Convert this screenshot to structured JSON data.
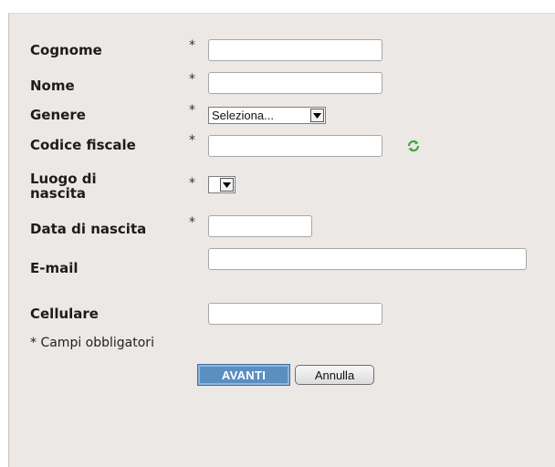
{
  "form": {
    "required_mark": "*",
    "fields": {
      "cognome": {
        "label": "Cognome",
        "value": ""
      },
      "nome": {
        "label": "Nome",
        "value": ""
      },
      "genere": {
        "label": "Genere",
        "selected": "Seleziona..."
      },
      "codice_fiscale": {
        "label": "Codice fiscale",
        "value": ""
      },
      "luogo_line1": "Luogo di",
      "luogo_line2": "nascita",
      "luogo_selected": "",
      "data_nascita": {
        "label": "Data di nascita",
        "value": ""
      },
      "email": {
        "label": "E-mail",
        "value": ""
      },
      "cellulare": {
        "label": "Cellulare",
        "value": ""
      }
    },
    "required_note": "* Campi obbligatori",
    "buttons": {
      "avanti": "AVANTI",
      "annulla": "Annulla"
    }
  },
  "colors": {
    "panel_bg": "#ebe8e6",
    "primary_button": "#5b8fc0",
    "refresh_icon": "#3aa83a"
  },
  "icons": {
    "refresh": "refresh-icon",
    "dropdown": "chevron-down-icon"
  }
}
